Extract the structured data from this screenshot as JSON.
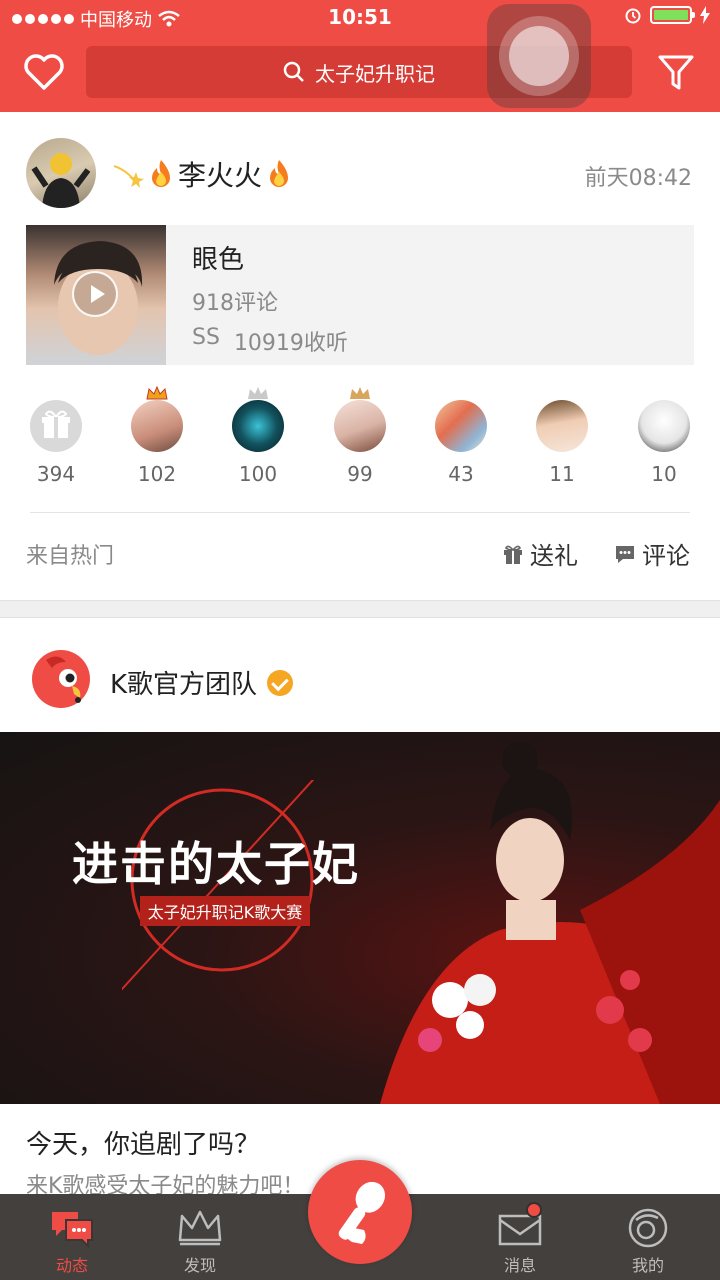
{
  "status_bar": {
    "carrier": "中国移动",
    "time": "10:51"
  },
  "header": {
    "search_text": "太子妃升职记"
  },
  "post1": {
    "username": "李火火",
    "time": "前天08:42",
    "song": {
      "title": "眼色",
      "comments": "918评论",
      "grade": "SS",
      "listens": "10919收听"
    },
    "gifters": [
      {
        "count": "394"
      },
      {
        "count": "102"
      },
      {
        "count": "100"
      },
      {
        "count": "99"
      },
      {
        "count": "43"
      },
      {
        "count": "11"
      },
      {
        "count": "10"
      }
    ],
    "source": "来自热门",
    "gift_label": "送礼",
    "comment_label": "评论"
  },
  "post2": {
    "username": "K歌官方团队",
    "banner_title": "进击的太子妃",
    "banner_subtitle": "太子妃升职记K歌大赛",
    "title": "今天，你追剧了吗？",
    "description": "来K歌感受太子妃的魅力吧！"
  },
  "tabs": [
    {
      "label": "动态",
      "icon": "feed-chat-icon"
    },
    {
      "label": "发现",
      "icon": "crown-icon"
    },
    {
      "label": "消息",
      "icon": "mail-icon"
    },
    {
      "label": "我的",
      "icon": "profile-face-icon"
    }
  ],
  "colors": {
    "brand_red": "#ef4c45",
    "verified_gold": "#f5a623"
  }
}
